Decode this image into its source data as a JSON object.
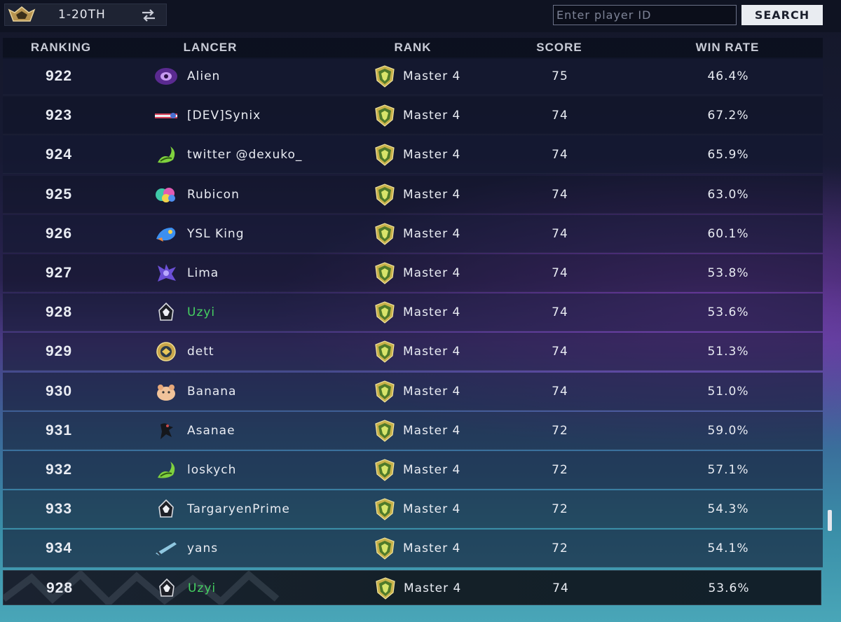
{
  "topbar": {
    "season_label": "1-20TH",
    "search_placeholder": "Enter player ID",
    "search_button": "SEARCH"
  },
  "columns": {
    "ranking": "RANKING",
    "lancer": "LANCER",
    "rank": "RANK",
    "score": "SCORE",
    "win_rate": "WIN RATE"
  },
  "colors": {
    "self_name": "#45d161",
    "search_button_bg": "#e9ecf1"
  },
  "rows": [
    {
      "pos": "922",
      "name": "Alien",
      "tier": "Master 4",
      "score": "75",
      "win": "46.4%",
      "avatar": "purple-orb-avatar"
    },
    {
      "pos": "923",
      "name": "[DEV]Synix",
      "tier": "Master 4",
      "score": "74",
      "win": "67.2%",
      "avatar": "flag-avatar"
    },
    {
      "pos": "924",
      "name": "twitter @dexuko_",
      "tier": "Master 4",
      "score": "74",
      "win": "65.9%",
      "avatar": "green-dragon-avatar"
    },
    {
      "pos": "925",
      "name": "Rubicon",
      "tier": "Master 4",
      "score": "74",
      "win": "63.0%",
      "avatar": "colorful-creature-avatar"
    },
    {
      "pos": "926",
      "name": "YSL King",
      "tier": "Master 4",
      "score": "74",
      "win": "60.1%",
      "avatar": "blue-bird-avatar"
    },
    {
      "pos": "927",
      "name": "Lima",
      "tier": "Master 4",
      "score": "74",
      "win": "53.8%",
      "avatar": "purple-sprite-avatar"
    },
    {
      "pos": "928",
      "name": "Uzyi",
      "tier": "Master 4",
      "score": "74",
      "win": "53.6%",
      "avatar": "helmet-avatar",
      "self": true
    },
    {
      "pos": "929",
      "name": "dett",
      "tier": "Master 4",
      "score": "74",
      "win": "51.3%",
      "avatar": "gold-emblem-avatar"
    },
    {
      "pos": "930",
      "name": "Banana",
      "tier": "Master 4",
      "score": "74",
      "win": "51.0%",
      "avatar": "hamster-avatar"
    },
    {
      "pos": "931",
      "name": "Asanae",
      "tier": "Master 4",
      "score": "72",
      "win": "59.0%",
      "avatar": "black-figure-avatar"
    },
    {
      "pos": "932",
      "name": "loskych",
      "tier": "Master 4",
      "score": "72",
      "win": "57.1%",
      "avatar": "green-dragon-avatar"
    },
    {
      "pos": "933",
      "name": "TargaryenPrime",
      "tier": "Master 4",
      "score": "72",
      "win": "54.3%",
      "avatar": "helmet-avatar"
    },
    {
      "pos": "934",
      "name": "yans",
      "tier": "Master 4",
      "score": "72",
      "win": "54.1%",
      "avatar": "blade-avatar"
    }
  ],
  "self_row": {
    "pos": "928",
    "name": "Uzyi",
    "tier": "Master 4",
    "score": "74",
    "win": "53.6%",
    "avatar": "helmet-avatar"
  }
}
